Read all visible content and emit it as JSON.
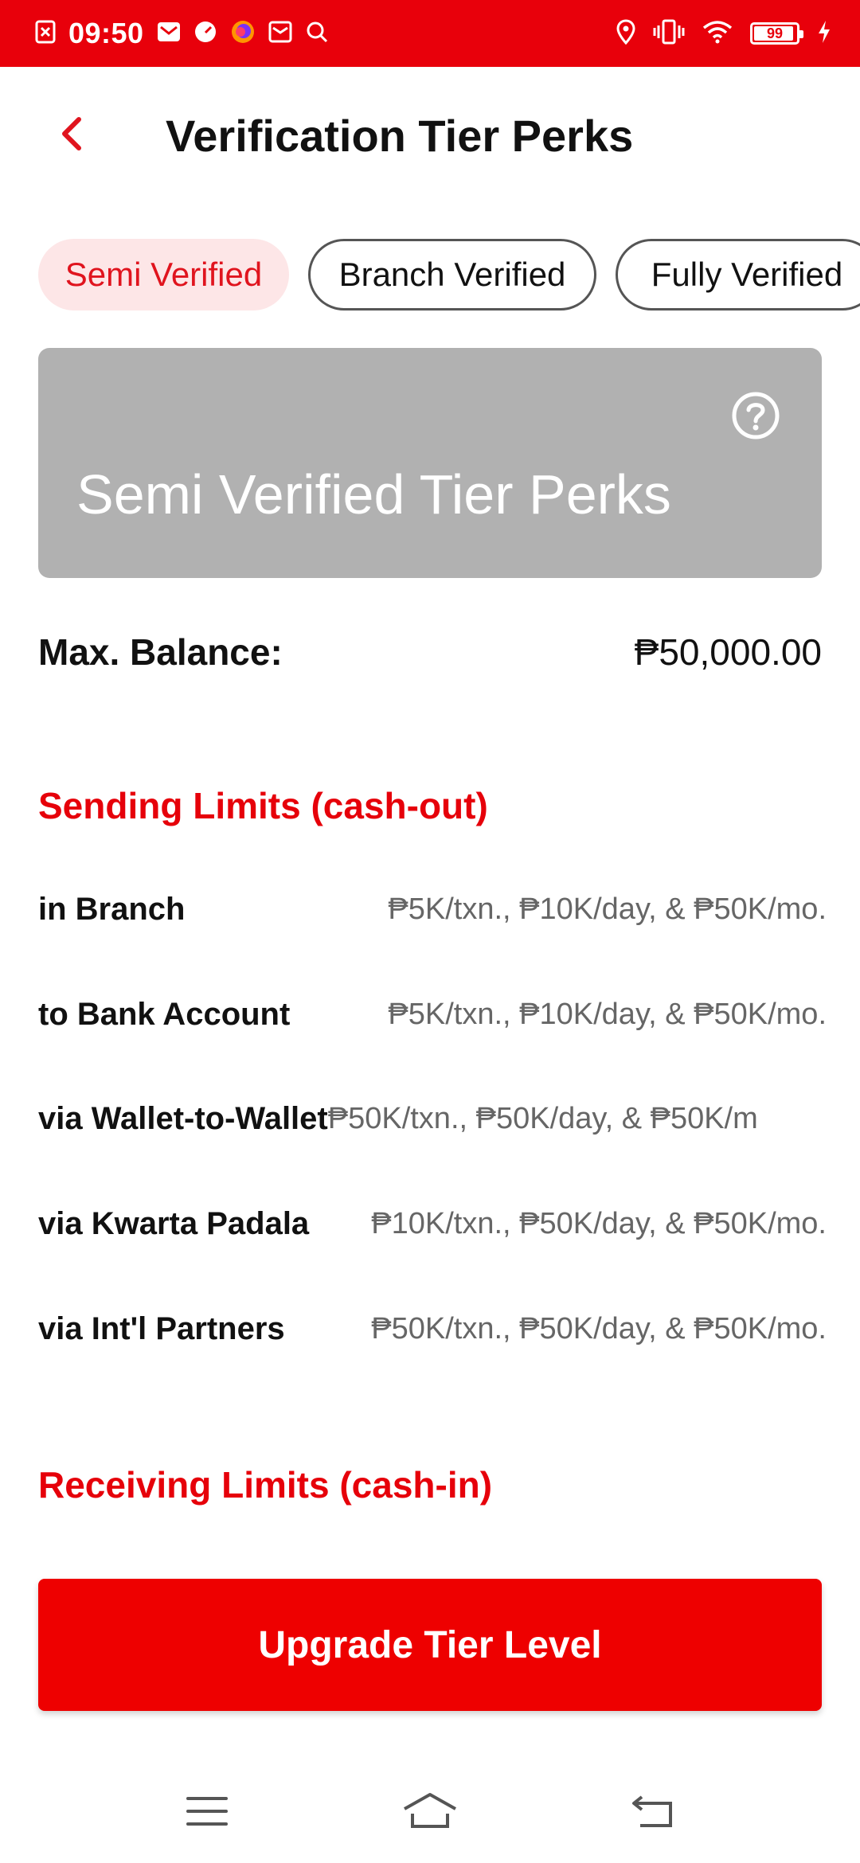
{
  "status_bar": {
    "time": "09:50",
    "battery": "99",
    "left_icons": [
      "notification-x-icon",
      "gmail-icon",
      "speedometer-icon",
      "firefox-icon",
      "mail-icon",
      "search-icon"
    ],
    "right_icons": [
      "location-icon",
      "vibrate-icon",
      "wifi-icon",
      "battery-icon",
      "charging-icon"
    ]
  },
  "header": {
    "title": "Verification Tier Perks"
  },
  "tabs": [
    {
      "label": "Semi Verified",
      "active": true
    },
    {
      "label": "Branch Verified",
      "active": false
    },
    {
      "label": "Fully Verified",
      "active": false
    }
  ],
  "banner": {
    "title": "Semi Verified Tier Perks"
  },
  "max_balance": {
    "label": "Max. Balance:",
    "value": "₱50,000.00"
  },
  "sending": {
    "heading": "Sending Limits (cash-out)",
    "rows": [
      {
        "label": "in Branch",
        "value": "₱5K/txn., ₱10K/day, & ₱50K/mo."
      },
      {
        "label": "to Bank Account",
        "value": "₱5K/txn., ₱10K/day, & ₱50K/mo."
      },
      {
        "label": "via Wallet-to-Wallet",
        "value": "₱50K/txn., ₱50K/day, & ₱50K/m"
      },
      {
        "label": "via Kwarta Padala",
        "value": "₱10K/txn., ₱50K/day, & ₱50K/mo."
      },
      {
        "label": "via Int'l Partners",
        "value": "₱50K/txn., ₱50K/day, & ₱50K/mo."
      }
    ]
  },
  "receiving": {
    "heading": "Receiving Limits (cash-in)"
  },
  "cta": {
    "label": "Upgrade Tier Level"
  },
  "colors": {
    "accent": "#e8000b",
    "tab_active_bg": "#fde6e7",
    "banner_bg": "#b1b1b1",
    "heading_red": "#e6000a",
    "value_gray": "#666666"
  },
  "nav_bar": [
    "menu-icon",
    "home-icon",
    "back-icon"
  ]
}
